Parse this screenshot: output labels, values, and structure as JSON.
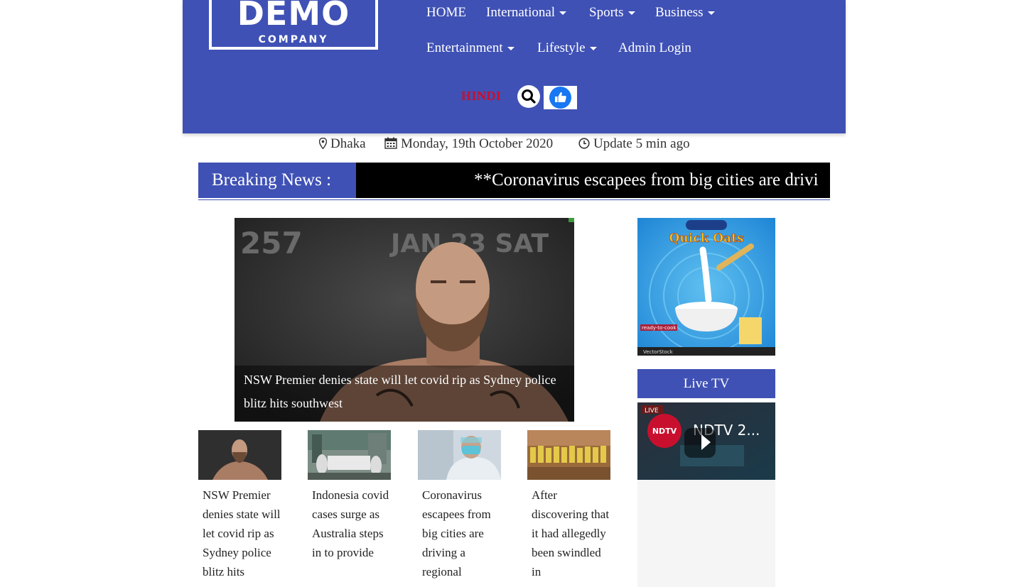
{
  "brand": {
    "logo_main": "DEMO",
    "logo_sub": "COMPANY"
  },
  "nav": {
    "home": "HOME",
    "international": "International",
    "sports": "Sports",
    "business": "Business",
    "entertainment": "Entertainment",
    "lifestyle": "Lifestyle",
    "admin_login": "Admin Login",
    "hindi": "HINDI"
  },
  "info": {
    "location": "Dhaka",
    "date": "Monday, 19th October 2020",
    "update": "Update 5 min ago"
  },
  "breaking": {
    "label": "Breaking News :",
    "text": "**Coronavirus escapees from big cities are drivi"
  },
  "featured": {
    "caption": "NSW Premier denies state will let covid rip as Sydney police blitz hits southwest",
    "image_text_1": "257",
    "image_text_2": "JAN 23 SAT"
  },
  "cards": [
    {
      "title": "NSW Premier denies state will let covid rip as Sydney police blitz hits"
    },
    {
      "title": "Indonesia covid cases surge as Australia steps in to provide"
    },
    {
      "title": "Coronavirus escapees from big cities are driving a regional"
    },
    {
      "title": "After discovering that it had allegedly been swindled in"
    }
  ],
  "sidebar": {
    "ad": {
      "title": "Quick Oats",
      "tag": "ready-to-cook",
      "footer": "VectorStock"
    },
    "live_tv": {
      "heading": "Live TV",
      "badge": "LIVE",
      "channel": "NDTV",
      "video_title": "NDTV 2..."
    }
  },
  "colors": {
    "header_bg": "#3f51b5",
    "breaking_bg": "#000000",
    "hindi": "#c8102e",
    "like": "#1877f2"
  },
  "icons": [
    "map-marker-icon",
    "calendar-icon",
    "clock-icon",
    "search-icon",
    "thumbs-up-icon",
    "play-icon",
    "caret-down-icon"
  ]
}
